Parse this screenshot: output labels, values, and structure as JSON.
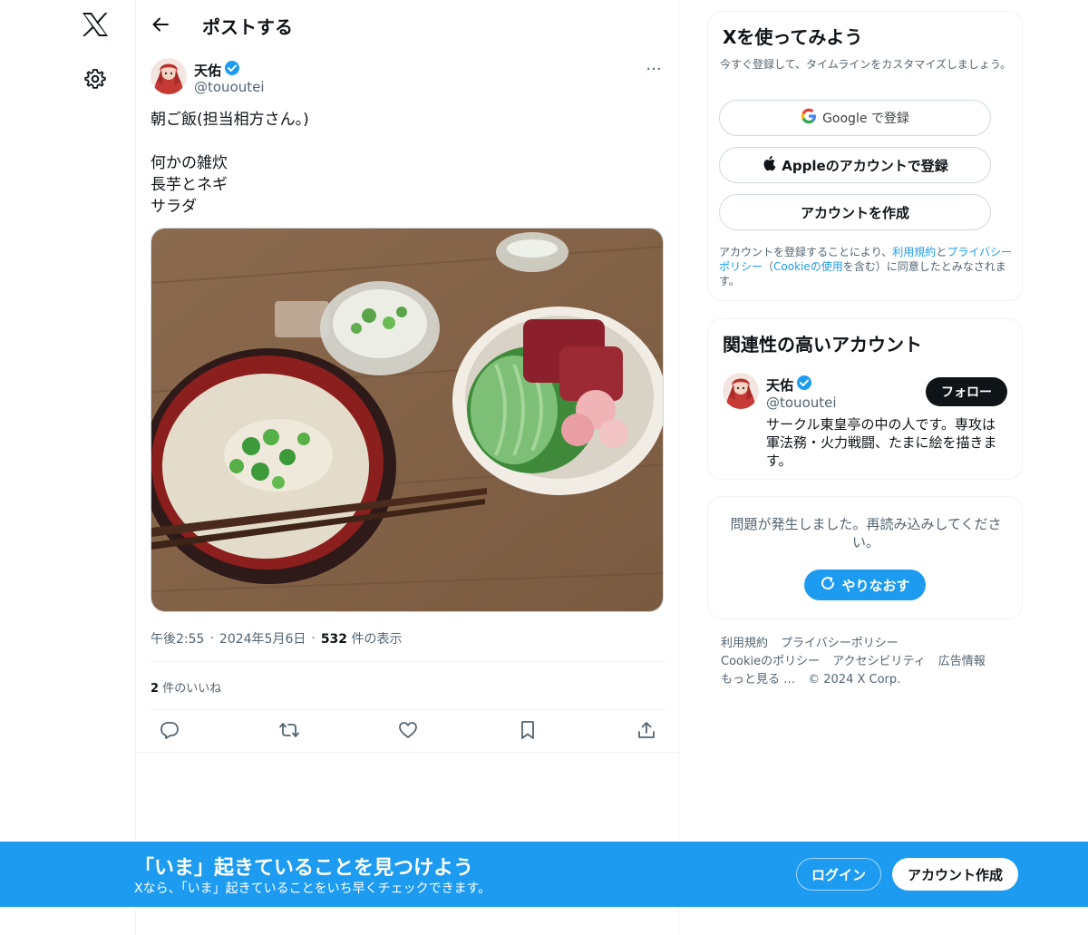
{
  "header": {
    "title": "ポストする"
  },
  "tweet": {
    "author_name": "天佑",
    "author_handle": "@tououtei",
    "more": "···",
    "lines": [
      "朝ご飯(担当相方さん。)",
      "",
      "何かの雑炊",
      "長芋とネギ",
      "サラダ"
    ],
    "time": "午後2:55",
    "date": "2024年5月6日",
    "dot": "·",
    "views_count": "532",
    "views_label": "件の表示",
    "likes_count": "2",
    "likes_label": "件のいいね"
  },
  "signup_card": {
    "title": "Xを使ってみよう",
    "subtitle": "今すぐ登録して、タイムラインをカスタマイズしましょう。",
    "google_label": "Google で登録",
    "apple_label": "Appleのアカウントで登録",
    "create_label": "アカウントを作成",
    "legal_1": "アカウントを登録することにより、",
    "terms_link": "利用規約",
    "legal_2": "と",
    "privacy_link": "プライバシーポリシー",
    "legal_3": "（",
    "cookie_link": "Cookieの使用",
    "legal_4": "を含む）に同意したとみなされます。"
  },
  "related_card": {
    "title": "関連性の高いアカウント",
    "account_name": "天佑",
    "account_handle": "@tououtei",
    "follow_label": "フォロー",
    "bio": "サークル東皇亭の中の人です。専攻は軍法務・火力戦闘、たまに絵を描きます。"
  },
  "error_card": {
    "message": "問題が発生しました。再読み込みしてください。",
    "retry_label": "やりなおす"
  },
  "footer": {
    "links_row1": [
      "利用規約",
      "プライバシーポリシー"
    ],
    "links_row2": [
      "Cookieのポリシー",
      "アクセシビリティ",
      "広告情報"
    ],
    "more": "もっと見る …",
    "copyright": "© 2024 X Corp."
  },
  "banner": {
    "title": "「いま」起きていることを見つけよう",
    "subtitle": "Xなら、「いま」起きていることをいち早くチェックできます。",
    "login_label": "ログイン",
    "signup_label": "アカウント作成"
  },
  "colors": {
    "accent": "#1d9bf0",
    "text": "#0f1419",
    "muted": "#536471",
    "border": "#eff3f4"
  }
}
